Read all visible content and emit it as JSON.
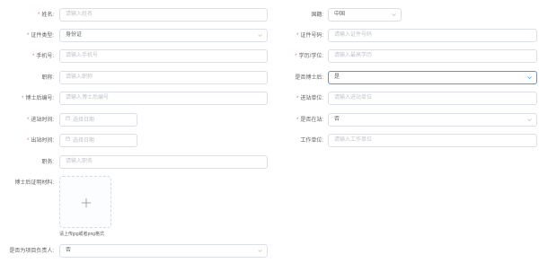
{
  "form": {
    "name": {
      "label": "姓名:",
      "placeholder": "请输入姓名",
      "required": "*"
    },
    "nationality": {
      "label": "国籍:",
      "value": "中国"
    },
    "id_type": {
      "label": "证件类型:",
      "value": "身份证",
      "required": "*"
    },
    "id_number": {
      "label": "证件号码:",
      "placeholder": "请输入证件号码",
      "required": "*"
    },
    "phone": {
      "label": "手机号:",
      "placeholder": "请输入手机号",
      "required": "*"
    },
    "degree": {
      "label": "学历/学位:",
      "placeholder": "请输入最高学历",
      "required": "*"
    },
    "position": {
      "label": "职称:",
      "placeholder": "请输入职称"
    },
    "is_postdoc": {
      "label": "是否博士后:",
      "value": "是"
    },
    "postdoc_no": {
      "label": "博士后编号:",
      "placeholder": "请输入博士后编号",
      "required": "*"
    },
    "entry_unit": {
      "label": "进站单位:",
      "placeholder": "请输入进站单位",
      "required": "*"
    },
    "entry_time": {
      "label": "进站时间:",
      "placeholder": "选择日期",
      "required": "*"
    },
    "in_station": {
      "label": "是否在站:",
      "value": "否",
      "required": "*"
    },
    "exit_time": {
      "label": "出站时间:",
      "placeholder": "选择日期",
      "required": "*"
    },
    "work_unit": {
      "label": "工作单位:",
      "placeholder": "请输入工作单位"
    },
    "job": {
      "label": "职务:",
      "placeholder": "请输入职务"
    },
    "postdoc_proof": {
      "label": "博士后证明材料:",
      "hint": "请上传jpg或者png格式"
    },
    "is_leader": {
      "label": "是否为项目负责人:",
      "value": "否"
    }
  },
  "colors": {
    "required": "#f56c6c",
    "focus_border": "#409eff",
    "border": "#dcdfe6",
    "placeholder": "#c0c4cc"
  }
}
